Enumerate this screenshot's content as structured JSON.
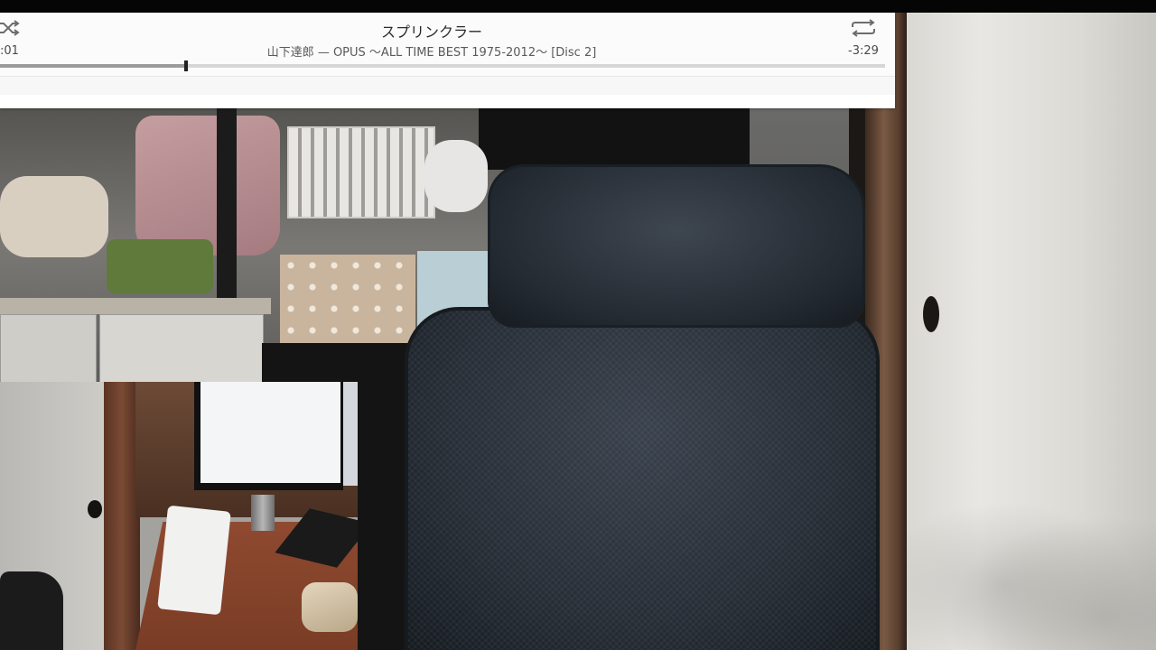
{
  "player": {
    "track_title": "スプリンクラー",
    "artist_album": "山下達郎 — OPUS ～ALL TIME BEST 1975-2012～ [Disc 2]",
    "elapsed": ":01",
    "remaining": "-3:29",
    "progress_fraction": 0.21,
    "icons": {
      "shuffle": "shuffle-icon",
      "repeat": "repeat-icon"
    }
  },
  "scene": {
    "main_view": "webcam-feed",
    "inset_view": "picture-in-picture-webcam"
  }
}
